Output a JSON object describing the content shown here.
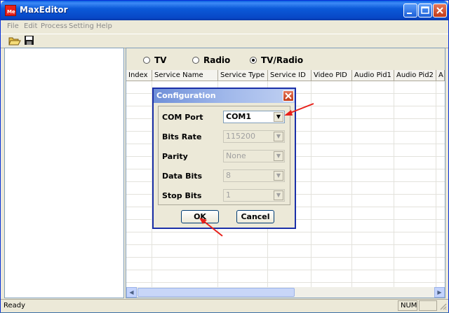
{
  "window": {
    "title": "MaxEditor",
    "icon": "app-icon"
  },
  "menu": {
    "items": [
      "File",
      "Edit",
      "Process",
      "Setting",
      "Help"
    ]
  },
  "toolbar": {
    "icons": [
      "open-folder-icon",
      "save-icon"
    ]
  },
  "channel_filter": {
    "options": [
      {
        "label": "TV",
        "selected": false
      },
      {
        "label": "Radio",
        "selected": false
      },
      {
        "label": "TV/Radio",
        "selected": true
      }
    ]
  },
  "grid": {
    "columns": [
      "Index",
      "Service Name",
      "Service Type",
      "Service ID",
      "Video PID",
      "Audio Pid1",
      "Audio Pid2",
      "A"
    ]
  },
  "dialog": {
    "title": "Configuration",
    "fields": [
      {
        "label": "COM Port",
        "value": "COM1",
        "enabled": true
      },
      {
        "label": "Bits Rate",
        "value": "115200",
        "enabled": false
      },
      {
        "label": "Parity",
        "value": "None",
        "enabled": false
      },
      {
        "label": "Data Bits",
        "value": "8",
        "enabled": false
      },
      {
        "label": "Stop Bits",
        "value": "1",
        "enabled": false
      }
    ],
    "ok_label": "OK",
    "cancel_label": "Cancel"
  },
  "status": {
    "text": "Ready",
    "num": "NUM"
  },
  "colors": {
    "titlebar": "#0b5ad8",
    "annotation_arrow": "#e8201a"
  }
}
